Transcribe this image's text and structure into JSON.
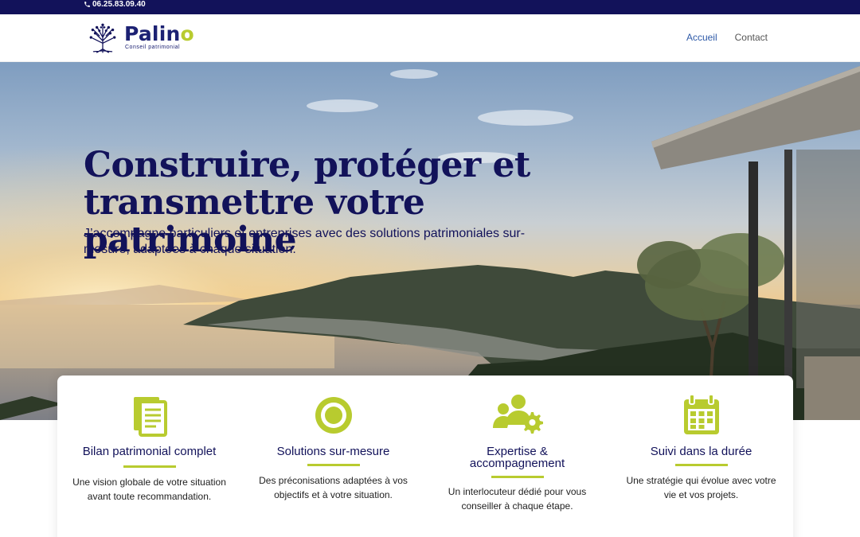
{
  "topbar": {
    "phone": "06.25.83.09.40",
    "phone_icon": "phone-icon"
  },
  "header": {
    "logo": {
      "brand_main": "Palin",
      "brand_accent": "o",
      "tagline": "Conseil patrimonial",
      "icon": "tree-icon"
    },
    "nav": [
      {
        "label": "Accueil",
        "active": true
      },
      {
        "label": "Contact",
        "active": false
      }
    ]
  },
  "hero": {
    "title_line1": "Construire, protéger et",
    "title_line2": "transmettre votre patrimoine",
    "subtitle": "J’accompagne particuliers et entreprises avec des solutions patrimoniales sur-mesure, adaptées à chaque situation."
  },
  "features": [
    {
      "icon": "document-icon",
      "title": "Bilan patrimonial complet",
      "description": "Une vision globale de votre situation avant toute recommandation."
    },
    {
      "icon": "target-icon",
      "title": "Solutions sur-mesure",
      "description": "Des préconisations adaptées à vos objectifs et à votre situation."
    },
    {
      "icon": "users-gear-icon",
      "title": "Expertise & accompagnement",
      "description": "Un interlocuteur dédié pour vous conseiller à chaque étape."
    },
    {
      "icon": "calendar-icon",
      "title": "Suivi dans la durée",
      "description": "Une stratégie qui évolue avec votre vie et vos projets."
    }
  ],
  "colors": {
    "navy": "#12125a",
    "accent": "#b8cb2f",
    "nav_active": "#2e5aa8"
  }
}
